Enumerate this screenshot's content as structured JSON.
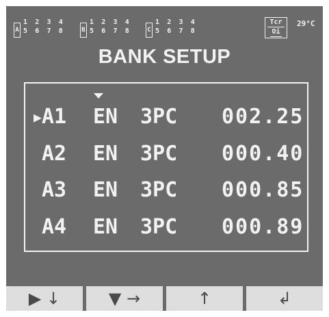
{
  "status": {
    "banks": [
      {
        "letter": "A",
        "top": "1 2 3 4",
        "bottom": "5 6 7 8"
      },
      {
        "letter": "B",
        "top": "1 2 3 4",
        "bottom": "5 6 7 8"
      },
      {
        "letter": "C",
        "top": "1 2 3 4",
        "bottom": "5 6 7 8"
      }
    ],
    "tcr_label": "Tcr",
    "tcr_sub": "Oi",
    "temperature": "29°C"
  },
  "title": "BANK SETUP",
  "table": {
    "rows": [
      {
        "id": "A1",
        "enable": "EN",
        "mode": "3PC",
        "value": "002.25",
        "cursor": "▶"
      },
      {
        "id": "A2",
        "enable": "EN",
        "mode": "3PC",
        "value": "000.40",
        "cursor": ""
      },
      {
        "id": "A3",
        "enable": "EN",
        "mode": "3PC",
        "value": "000.85",
        "cursor": ""
      },
      {
        "id": "A4",
        "enable": "EN",
        "mode": "3PC",
        "value": "000.89",
        "cursor": ""
      }
    ]
  },
  "softkeys": [
    {
      "label": "▶ ↓",
      "icon": "play-down-icon"
    },
    {
      "label": "▼ →",
      "icon": "down-right-icon"
    },
    {
      "label": "↑",
      "icon": "up-arrow-icon"
    },
    {
      "label": "↲",
      "icon": "enter-icon"
    }
  ],
  "colors": {
    "screen": "#6b6b6b",
    "text": "#f2f2f2",
    "softkey": "#dedede"
  }
}
